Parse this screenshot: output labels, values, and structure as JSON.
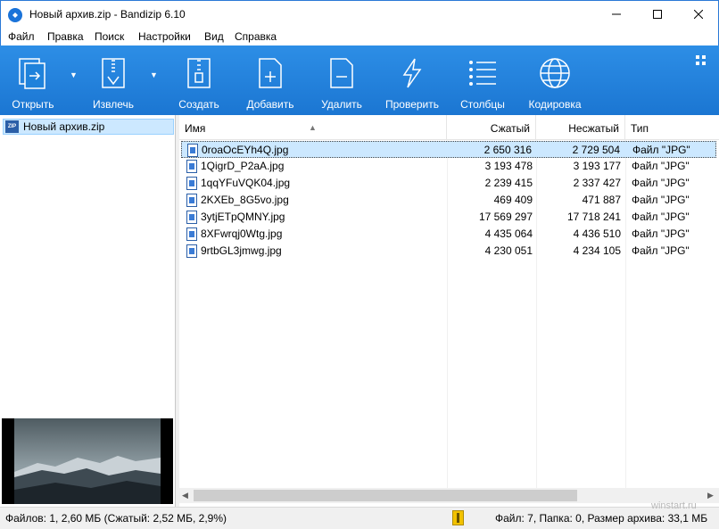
{
  "window": {
    "title": "Новый архив.zip - Bandizip 6.10"
  },
  "menu": [
    "Файл",
    "Правка",
    "Поиск",
    "Настройки",
    "Вид",
    "Справка"
  ],
  "toolbar": {
    "open": "Открыть",
    "extract": "Извлечь",
    "create": "Создать",
    "add": "Добавить",
    "delete": "Удалить",
    "test": "Проверить",
    "columns": "Столбцы",
    "encoding": "Кодировка"
  },
  "tree": {
    "archive": "Новый архив.zip",
    "icon_text": "ZIP"
  },
  "columns": {
    "name": "Имя",
    "compressed": "Сжатый",
    "uncompressed": "Несжатый",
    "type": "Тип"
  },
  "files": [
    {
      "name": "0roaOcEYh4Q.jpg",
      "compressed": "2 650 316",
      "uncompressed": "2 729 504",
      "type": "Файл \"JPG\""
    },
    {
      "name": "1QigrD_P2aA.jpg",
      "compressed": "3 193 478",
      "uncompressed": "3 193 177",
      "type": "Файл \"JPG\""
    },
    {
      "name": "1qqYFuVQK04.jpg",
      "compressed": "2 239 415",
      "uncompressed": "2 337 427",
      "type": "Файл \"JPG\""
    },
    {
      "name": "2KXEb_8G5vo.jpg",
      "compressed": "469 409",
      "uncompressed": "471 887",
      "type": "Файл \"JPG\""
    },
    {
      "name": "3ytjETpQMNY.jpg",
      "compressed": "17 569 297",
      "uncompressed": "17 718 241",
      "type": "Файл \"JPG\""
    },
    {
      "name": "8XFwrqj0Wtg.jpg",
      "compressed": "4 435 064",
      "uncompressed": "4 436 510",
      "type": "Файл \"JPG\""
    },
    {
      "name": "9rtbGL3jmwg.jpg",
      "compressed": "4 230 051",
      "uncompressed": "4 234 105",
      "type": "Файл \"JPG\""
    }
  ],
  "status": {
    "left": "Файлов: 1, 2,60 МБ (Сжатый: 2,52 МБ, 2,9%)",
    "right": "Файл: 7, Папка: 0, Размер архива: 33,1 МБ"
  },
  "watermark": "winstart.ru",
  "colors": {
    "toolbar": "#1b76d2",
    "selection": "#cce8ff",
    "accent": "#2b79d6"
  }
}
